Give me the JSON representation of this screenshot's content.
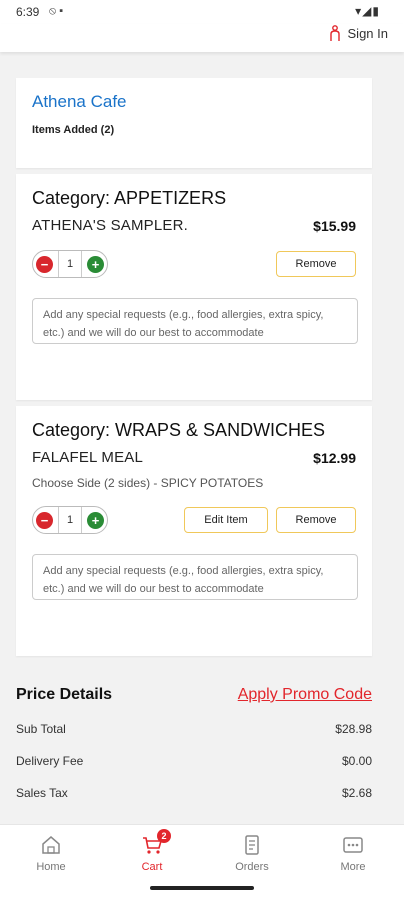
{
  "status_bar": {
    "time": "6:39",
    "left_icons": "⦸ ▪",
    "right_icons": "▾◢▮"
  },
  "header": {
    "signin_label": "Sign In"
  },
  "restaurant": {
    "name": "Athena Cafe",
    "items_added": "Items Added (2)"
  },
  "cart_items": [
    {
      "category": "Category: APPETIZERS",
      "name": "ATHENA'S SAMPLER.",
      "price": "$15.99",
      "quantity": "1",
      "remove_label": "Remove",
      "requests_placeholder": "Add any special requests (e.g., food allergies, extra spicy, etc.) and we will do our best to accommodate"
    },
    {
      "category": "Category: WRAPS & SANDWICHES",
      "name": "FALAFEL MEAL",
      "price": "$12.99",
      "side": "Choose Side (2 sides) - SPICY POTATOES",
      "quantity": "1",
      "edit_label": "Edit Item",
      "remove_label": "Remove",
      "requests_placeholder": "Add any special requests (e.g., food allergies, extra spicy, etc.) and we will do our best to accommodate"
    }
  ],
  "price_details": {
    "title": "Price Details",
    "promo_label": "Apply Promo Code",
    "rows": [
      {
        "label": "Sub Total",
        "value": "$28.98"
      },
      {
        "label": "Delivery Fee",
        "value": "$0.00"
      },
      {
        "label": "Sales Tax",
        "value": "$2.68"
      }
    ]
  },
  "bottom_nav": {
    "items": [
      {
        "label": "Home",
        "icon": "home-icon"
      },
      {
        "label": "Cart",
        "icon": "cart-icon",
        "badge": "2",
        "active": true
      },
      {
        "label": "Orders",
        "icon": "orders-icon"
      },
      {
        "label": "More",
        "icon": "more-icon"
      }
    ]
  },
  "colors": {
    "accent": "#e2262c",
    "link": "#1a73c9",
    "minus": "#d8272d",
    "plus": "#2a8c36",
    "button_border": "#f0c85a"
  }
}
